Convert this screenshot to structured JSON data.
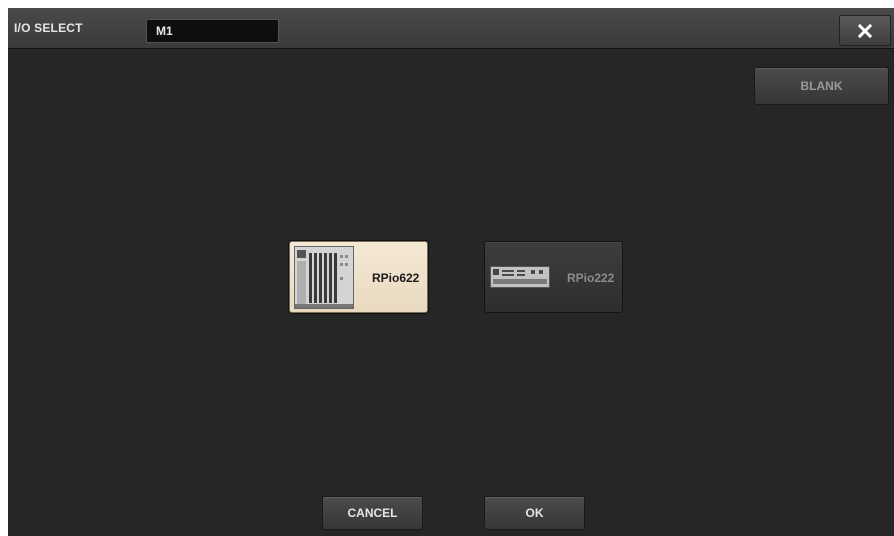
{
  "window": {
    "title": "I/O SELECT",
    "name_value": "M1",
    "close_icon": "close-icon"
  },
  "actions": {
    "blank_label": "BLANK",
    "cancel_label": "CANCEL",
    "ok_label": "OK"
  },
  "devices": [
    {
      "label": "RPio622",
      "selected": true,
      "icon": "rpio622-rack-icon"
    },
    {
      "label": "RPio222",
      "selected": false,
      "icon": "rpio222-rack-icon"
    }
  ],
  "colors": {
    "background": "#262626",
    "titlebar": "#404040",
    "selected_device": "#f1e4cd",
    "unselected_device": "#363636",
    "text_light": "#e6e6e6",
    "text_dim": "#8c8c8c"
  }
}
